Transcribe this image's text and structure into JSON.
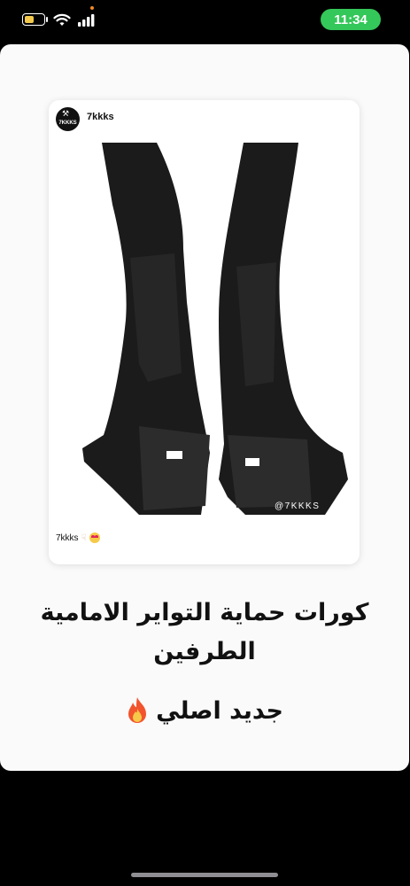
{
  "status_bar": {
    "time": "11:34",
    "battery_level": 0.5,
    "icons": [
      "battery-icon",
      "wifi-icon",
      "signal-icon"
    ],
    "colors": {
      "time_pill": "#34c759",
      "battery": "#f2c94c",
      "privacy_dot": "#f08a24"
    }
  },
  "post": {
    "avatar_text": "7KKKS",
    "username": "7kkks",
    "watermark": "@7KKKS",
    "caption_text": "7kkks",
    "caption_icons": [
      "pointing-down-emoji",
      "heart-eyes-emoji"
    ]
  },
  "story": {
    "title_line1": "كورات حماية التواير الامامية",
    "title_line2": "الطرفين",
    "subtitle": "جديد اصلي",
    "subtitle_icon": "fire-emoji"
  }
}
